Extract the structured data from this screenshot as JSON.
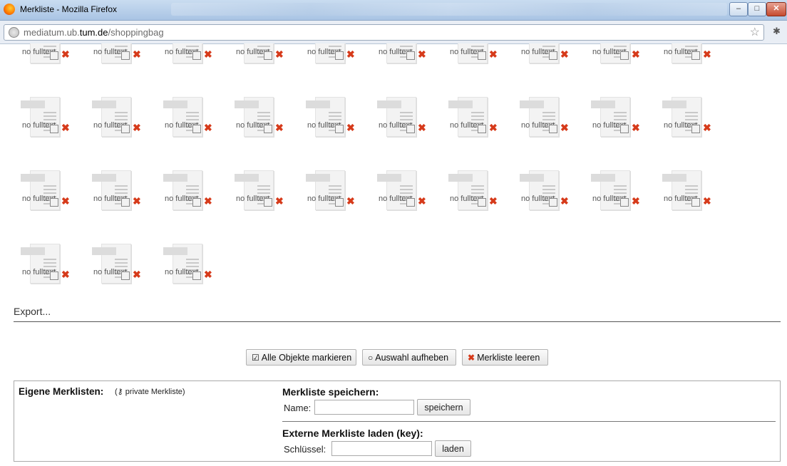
{
  "window": {
    "title": "Merkliste - Mozilla Firefox",
    "min": "–",
    "max": "□",
    "close": "✕"
  },
  "url": {
    "host_pre": "mediatum.ub.",
    "host_bold": "tum.de",
    "path": "/shoppingbag"
  },
  "items": {
    "count": 33,
    "label": "no fulltext",
    "remove_glyph": "✖"
  },
  "export_label": "Export...",
  "actions": {
    "mark_all": "Alle Objekte markieren",
    "unselect": "Auswahl aufheben",
    "clear": "Merkliste leeren"
  },
  "panel": {
    "own_title": "Eigene Merklisten:",
    "own_note_open": "(",
    "own_note": "private Merkliste",
    "own_note_close": ")",
    "save_title": "Merkliste speichern:",
    "name_label": "Name:",
    "save_button": "speichern",
    "ext_title": "Externe Merkliste laden (key):",
    "key_label": "Schlüssel:",
    "load_button": "laden"
  },
  "colors": {
    "remove": "#d63a1a",
    "titlebar": "#b8cfe8"
  }
}
